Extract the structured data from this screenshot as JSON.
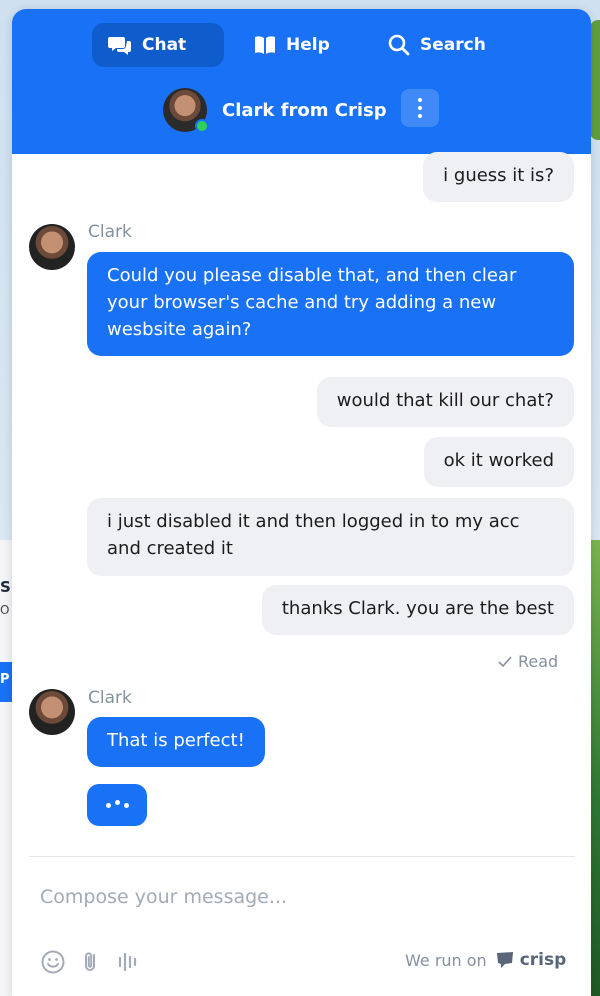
{
  "header": {
    "tabs": [
      {
        "label": "Chat",
        "icon": "chat-icon",
        "active": true
      },
      {
        "label": "Help",
        "icon": "book-icon",
        "active": false
      },
      {
        "label": "Search",
        "icon": "search-icon",
        "active": false
      }
    ],
    "operator_name": "Clark from Crisp",
    "operator_status": "online"
  },
  "messages": [
    {
      "from": "user",
      "text": "i guess it is?"
    },
    {
      "from": "operator",
      "sender": "Clark",
      "text": "Could you please disable that, and then clear your browser's cache and try adding a new wesbsite again?"
    },
    {
      "from": "user",
      "text": "would that kill our chat?"
    },
    {
      "from": "user",
      "text": "ok it worked"
    },
    {
      "from": "user",
      "text": "i just disabled it and then logged in to my acc and created it"
    },
    {
      "from": "user",
      "text": "thanks Clark. you are the best"
    },
    {
      "status": "Read"
    },
    {
      "from": "operator",
      "sender": "Clark",
      "text": "That is perfect!"
    },
    {
      "from": "operator",
      "typing": true
    }
  ],
  "composer": {
    "placeholder": "Compose your message..."
  },
  "footer": {
    "powered_by": "We run on",
    "brand": "crisp"
  },
  "colors": {
    "accent": "#1972f5",
    "bubble_gray": "#eff0f3",
    "online": "#2fd05a"
  }
}
